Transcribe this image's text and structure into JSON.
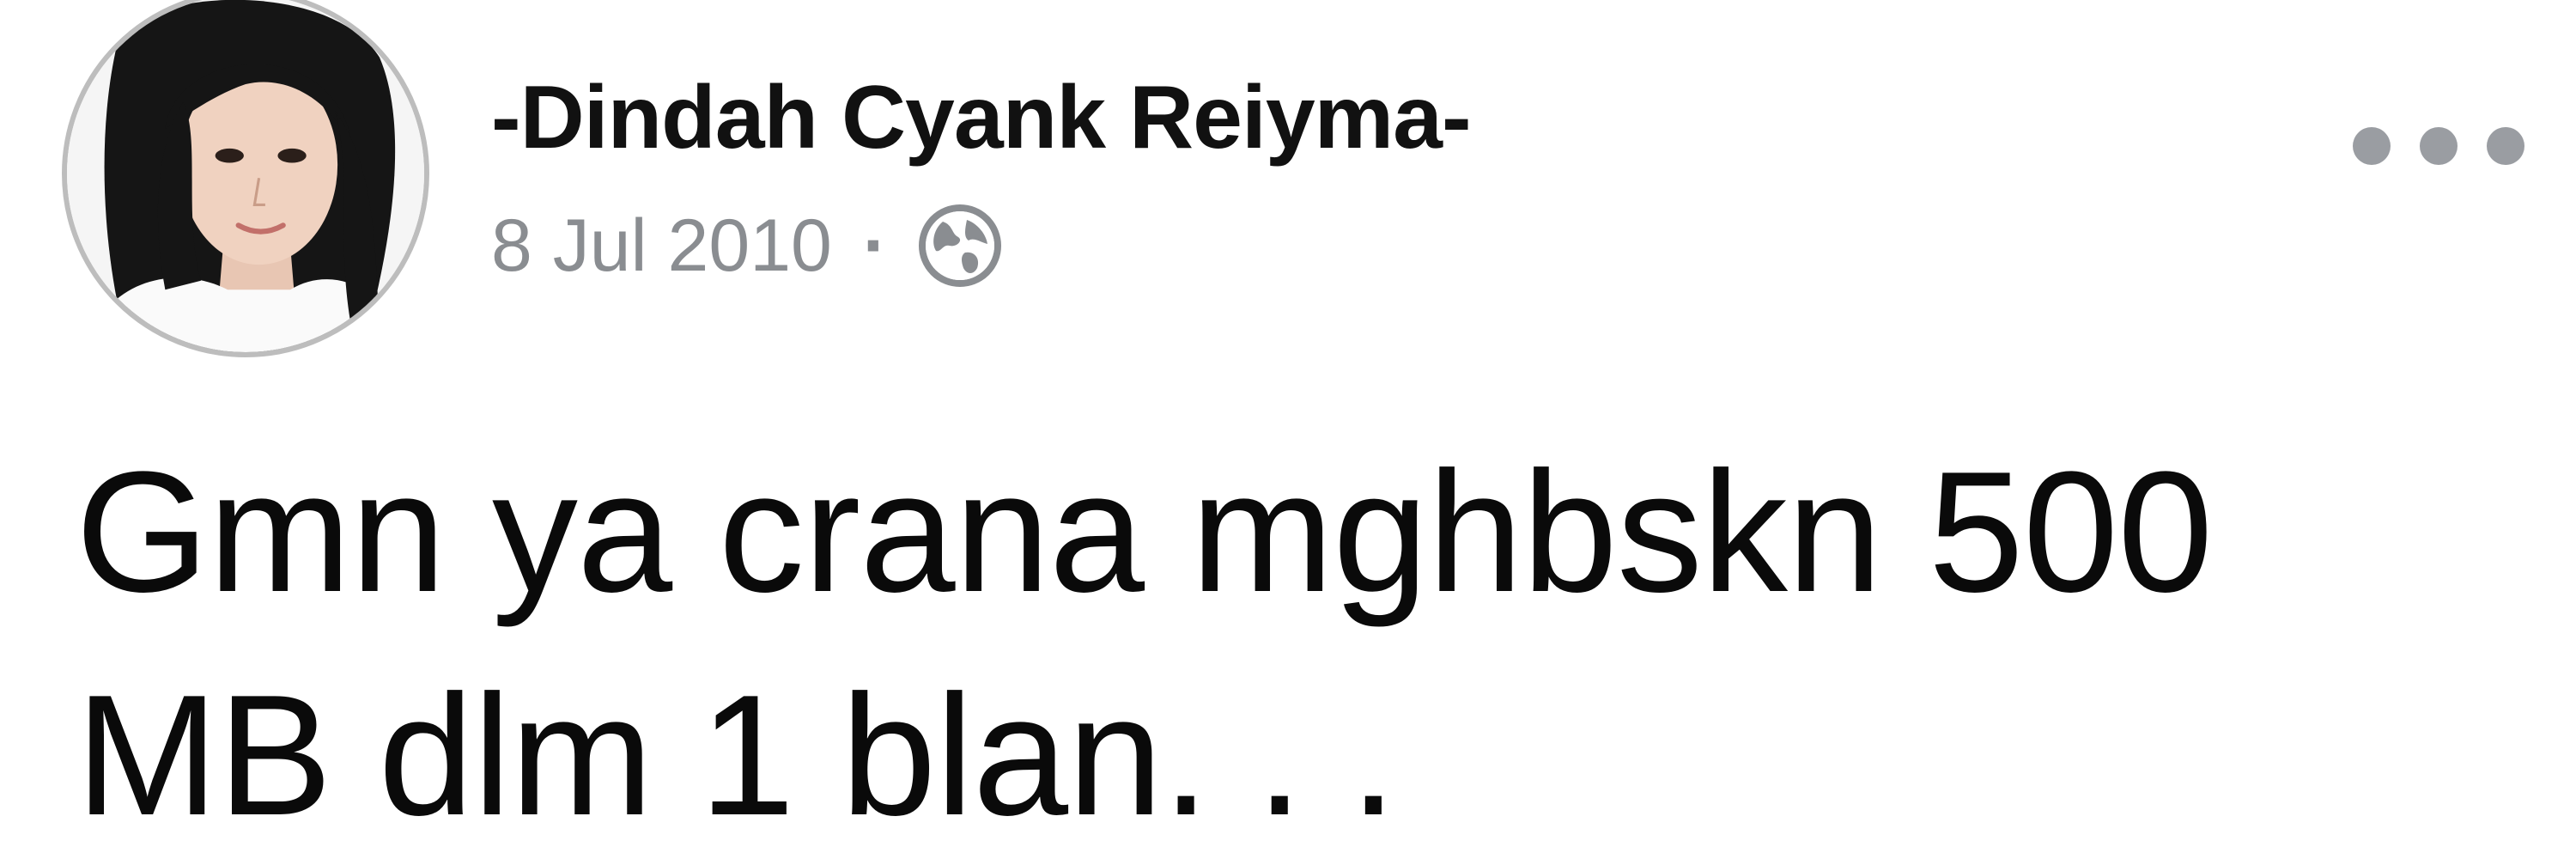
{
  "post": {
    "author": {
      "name": "-Dindah Cyank Reiyma-",
      "avatar_icon": "profile-photo"
    },
    "meta": {
      "date": "8 Jul 2010",
      "separator": "·",
      "privacy_icon": "globe-icon"
    },
    "more_icon": "more-options-icon",
    "text_lines": [
      "Gmn ya crana mghbskn 500",
      "MB dlm 1 blan. . ."
    ]
  },
  "colors": {
    "text": "#0a0a0a",
    "meta_text": "#8a8d91",
    "avatar_border": "#bdbdbd",
    "more_dots": "#9a9da2"
  }
}
